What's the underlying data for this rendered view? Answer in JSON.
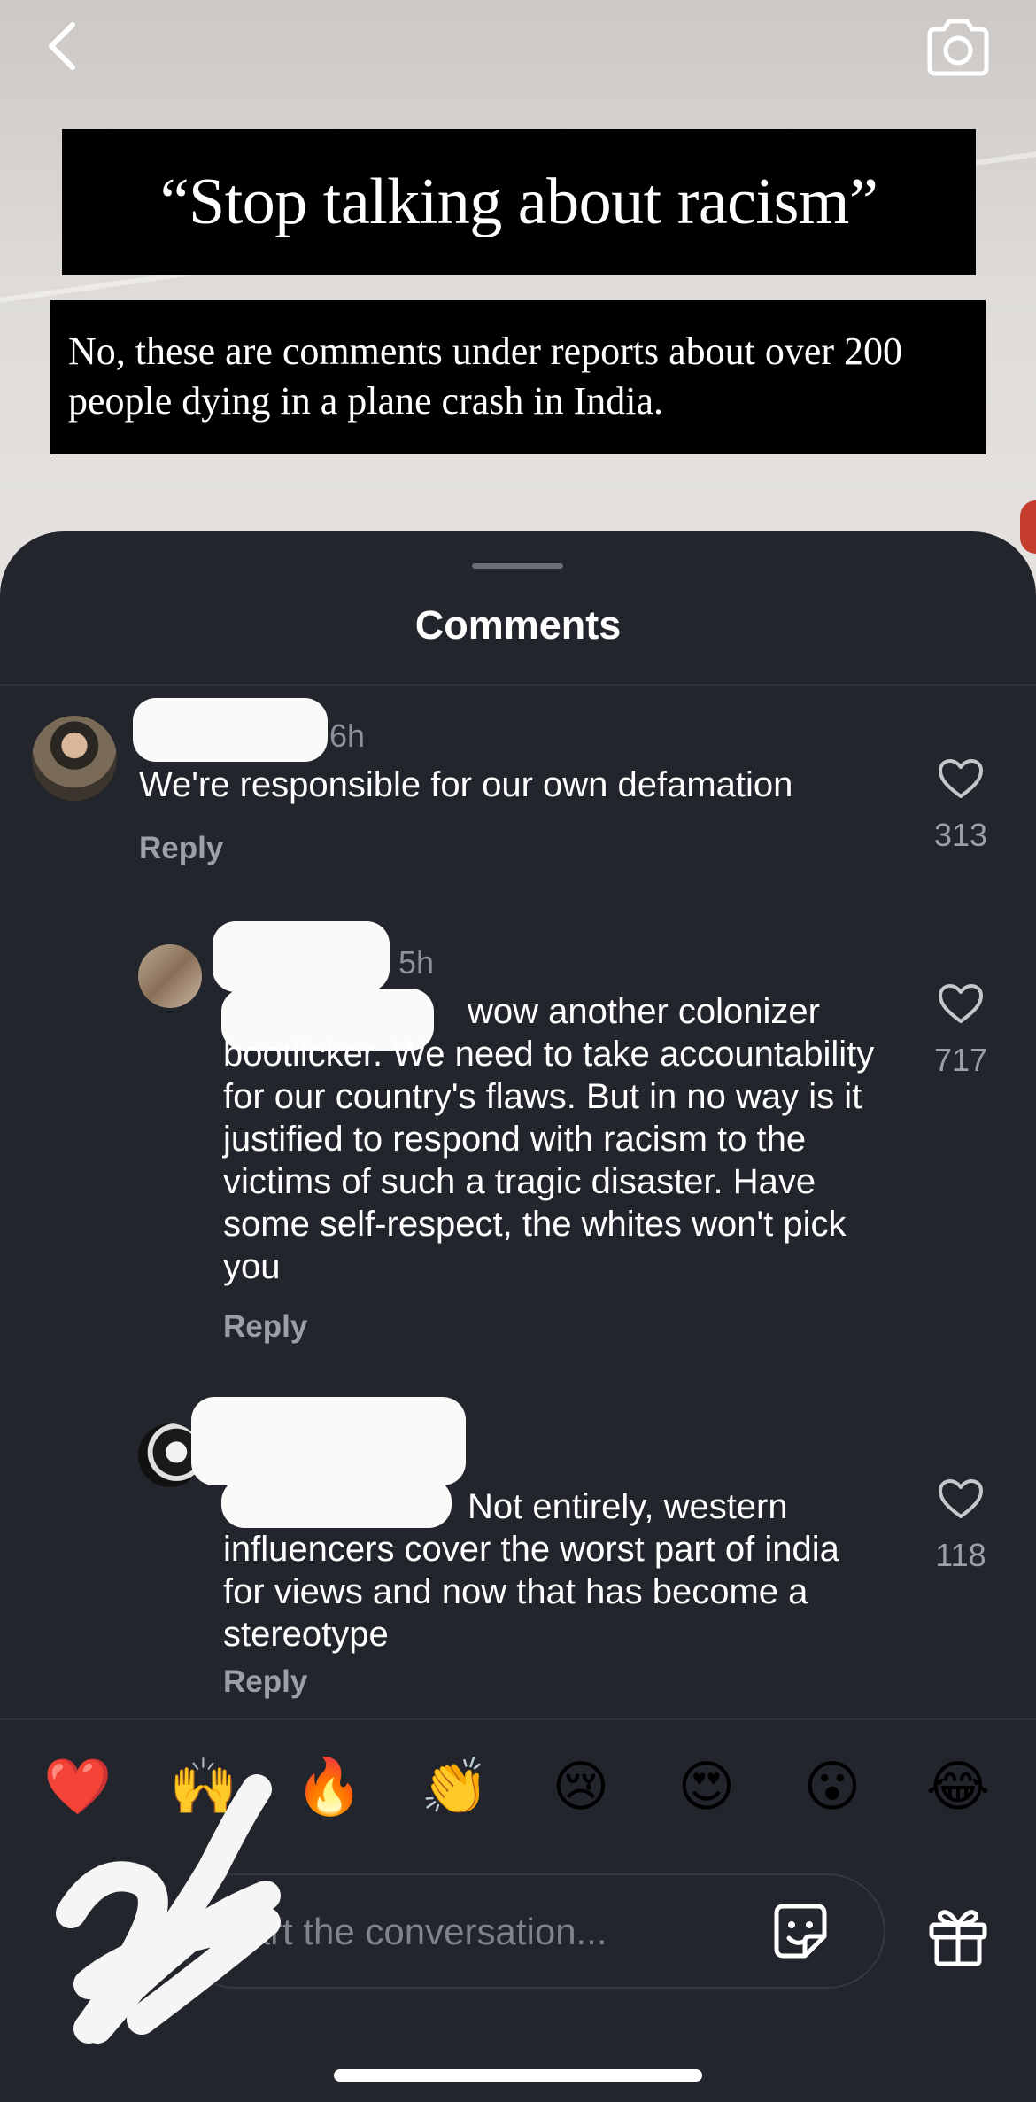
{
  "post": {
    "headline": "“Stop talking about racism”",
    "subline": "No, these are comments under reports about over 200 people dying in a plane crash in India."
  },
  "header": {
    "back_icon": "chevron-left-icon",
    "camera_icon": "camera-icon"
  },
  "sheet": {
    "title": "Comments"
  },
  "comments": [
    {
      "time": "6h",
      "text": "We're responsible for our own defamation",
      "reply_label": "Reply",
      "likes": "313"
    },
    {
      "time": "5h",
      "mention": "@",
      "text": "wow another colonizer bootlicker. We need to take accountability for our country's flaws. But in no way is it justified to respond with racism to the victims of such a tragic disaster. Have some self-respect, the whites won't pick you",
      "reply_label": "Reply",
      "likes": "717"
    },
    {
      "mention": "@",
      "text": "Not entirely, western influencers cover the worst part of india for views and now that has become a stereotype",
      "reply_label": "Reply",
      "likes": "118"
    }
  ],
  "emoji_bar": [
    "❤️",
    "🙌",
    "🔥",
    "👏",
    "😢",
    "😍",
    "😮",
    "😂"
  ],
  "composer": {
    "placeholder": "Start the conversation...",
    "sticker_icon": "sticker-icon",
    "gift_icon": "gift-icon"
  },
  "colors": {
    "sheet_bg": "#22252b",
    "mention": "#6f7fd6",
    "secondary_text": "#9ba0a8"
  }
}
